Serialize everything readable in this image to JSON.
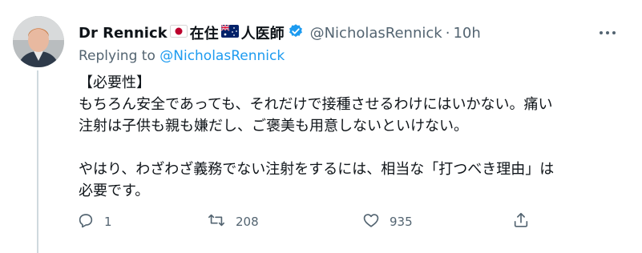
{
  "author": {
    "name": "Dr Rennick",
    "location_text_1": "在住",
    "location_text_2": "人医師",
    "handle": "@NicholasRennick",
    "separator": "·",
    "time": "10h",
    "flags": [
      "japan-flag",
      "australia-flag"
    ],
    "verified_color": "#1d9bf0"
  },
  "reply": {
    "prefix": "Replying to",
    "mention": "@NicholasRennick"
  },
  "body": {
    "line1": "【必要性】",
    "line2": "もちろん安全であっても、それだけで接種させるわけにはいかない。痛い",
    "line3": "注射は子供も親も嫌だし、ご褒美も用意しないといけない。",
    "line4": "やはり、わざわざ義務でない注射をするには、相当な「打つべき理由」は",
    "line5": "必要です。"
  },
  "actions": {
    "reply_count": "1",
    "retweet_count": "208",
    "like_count": "935"
  },
  "colors": {
    "text": "#0f1419",
    "secondary": "#536471",
    "accent": "#1d9bf0"
  }
}
